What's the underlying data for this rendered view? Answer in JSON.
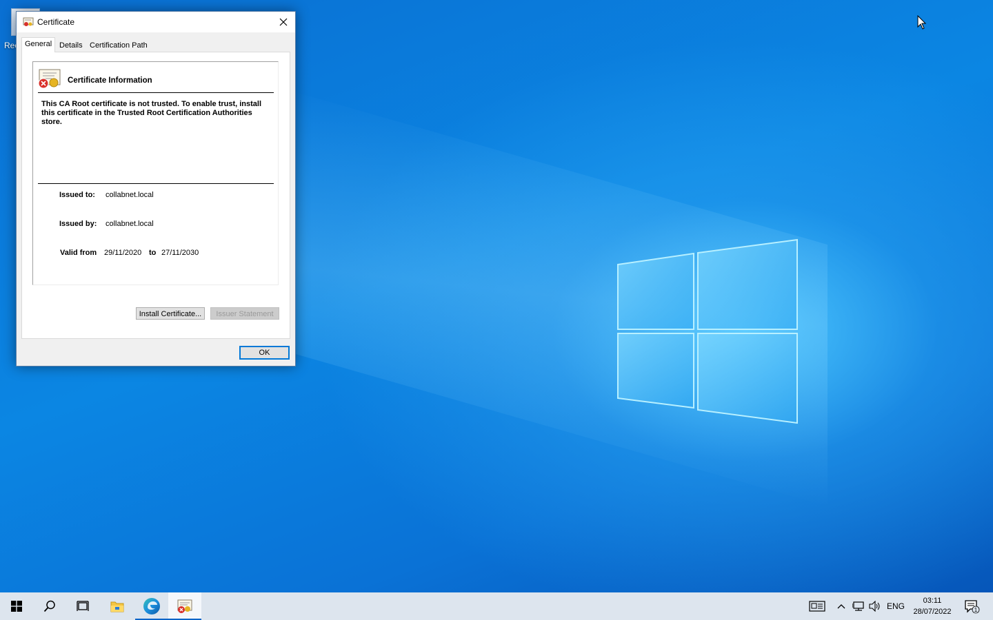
{
  "desktop": {
    "icon_label": "Rec"
  },
  "dialog": {
    "title": "Certificate",
    "tabs": [
      {
        "label": "General",
        "active": true
      },
      {
        "label": "Details",
        "active": false
      },
      {
        "label": "Certification Path",
        "active": false
      }
    ],
    "info_title": "Certificate Information",
    "warning": "This CA Root certificate is not trusted. To enable trust, install this certificate in the Trusted Root Certification Authorities store.",
    "issued_to_label": "Issued to:",
    "issued_to_value": "collabnet.local",
    "issued_by_label": "Issued by:",
    "issued_by_value": "collabnet.local",
    "valid_from_label": "Valid from",
    "valid_from_value": "29/11/2020",
    "valid_to_label": "to",
    "valid_to_value": "27/11/2030",
    "install_button": "Install Certificate...",
    "issuer_statement_button": "Issuer Statement",
    "ok_button": "OK"
  },
  "taskbar": {
    "items": [
      "start-icon",
      "search-icon",
      "task-view-icon",
      "file-explorer-icon",
      "edge-icon",
      "certificate-icon"
    ],
    "language": "ENG",
    "time": "03:11",
    "date": "28/07/2022",
    "notification_count": "1"
  },
  "colors": {
    "desktop_blue": "#0b7ad9",
    "accent": "#0078d7",
    "taskbar": "#dde5ee"
  }
}
